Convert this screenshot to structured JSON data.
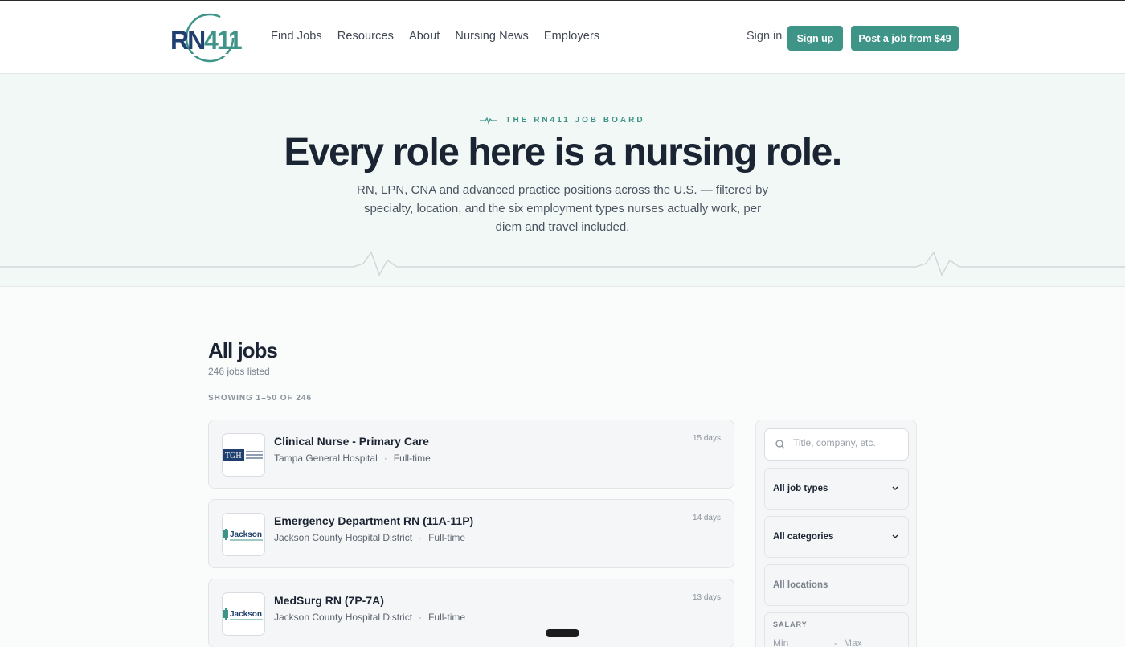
{
  "header": {
    "logo_alt": "RN411 Nursing Jobs Nursing 411",
    "nav": [
      {
        "label": "Find Jobs"
      },
      {
        "label": "Resources"
      },
      {
        "label": "About"
      },
      {
        "label": "Nursing News"
      },
      {
        "label": "Employers"
      }
    ],
    "sign_in": "Sign in",
    "sign_up": "Sign up",
    "post_job": "Post a job from $49",
    "accent_color": "#3f9488"
  },
  "hero": {
    "eyebrow": "THE RN411 JOB BOARD",
    "title": "Every role here is a nursing role.",
    "subtitle": "RN, LPN, CNA and advanced practice positions across the U.S. — filtered by specialty, location, and the six employment types nurses actually work, per diem and travel included."
  },
  "jobs": {
    "title": "All jobs",
    "count": "246 jobs listed",
    "showing": "SHOWING 1–50 OF 246",
    "items": [
      {
        "title": "Clinical Nurse - Primary Care",
        "company": "Tampa General Hospital",
        "type": "Full-time",
        "age": "15 days",
        "logo": "tgh-logo"
      },
      {
        "title": "Emergency Department RN (11A-11P)",
        "company": "Jackson County Hospital District",
        "type": "Full-time",
        "age": "14 days",
        "logo": "jackson-logo"
      },
      {
        "title": "MedSurg RN (7P-7A)",
        "company": "Jackson County Hospital District",
        "type": "Full-time",
        "age": "13 days",
        "logo": "jackson-logo"
      }
    ]
  },
  "filters": {
    "search_placeholder": "Title, company, etc.",
    "job_types": "All job types",
    "categories": "All categories",
    "locations": "All locations",
    "salary_label": "SALARY",
    "salary_min": "Min",
    "salary_sep": "-",
    "salary_max": "Max"
  }
}
